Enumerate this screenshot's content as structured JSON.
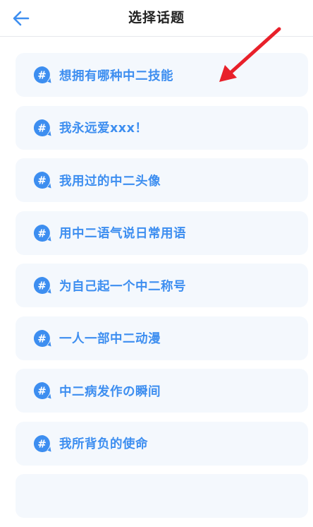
{
  "header": {
    "title": "选择话题",
    "back_icon": "arrow-left-icon"
  },
  "colors": {
    "accent": "#3d8ef0",
    "item_bg": "#f4f8fd",
    "annotation_arrow": "#e8202a"
  },
  "topics": [
    {
      "label": "想拥有哪种中二技能",
      "icon": "hashtag-icon"
    },
    {
      "label": "我永远爱xxx！",
      "icon": "hashtag-icon"
    },
    {
      "label": "我用过的中二头像",
      "icon": "hashtag-icon"
    },
    {
      "label": "用中二语气说日常用语",
      "icon": "hashtag-icon"
    },
    {
      "label": "为自己起一个中二称号",
      "icon": "hashtag-icon"
    },
    {
      "label": "一人一部中二动漫",
      "icon": "hashtag-icon"
    },
    {
      "label": "中二病发作の瞬间",
      "icon": "hashtag-icon"
    },
    {
      "label": "我所背负的使命",
      "icon": "hashtag-icon"
    }
  ]
}
